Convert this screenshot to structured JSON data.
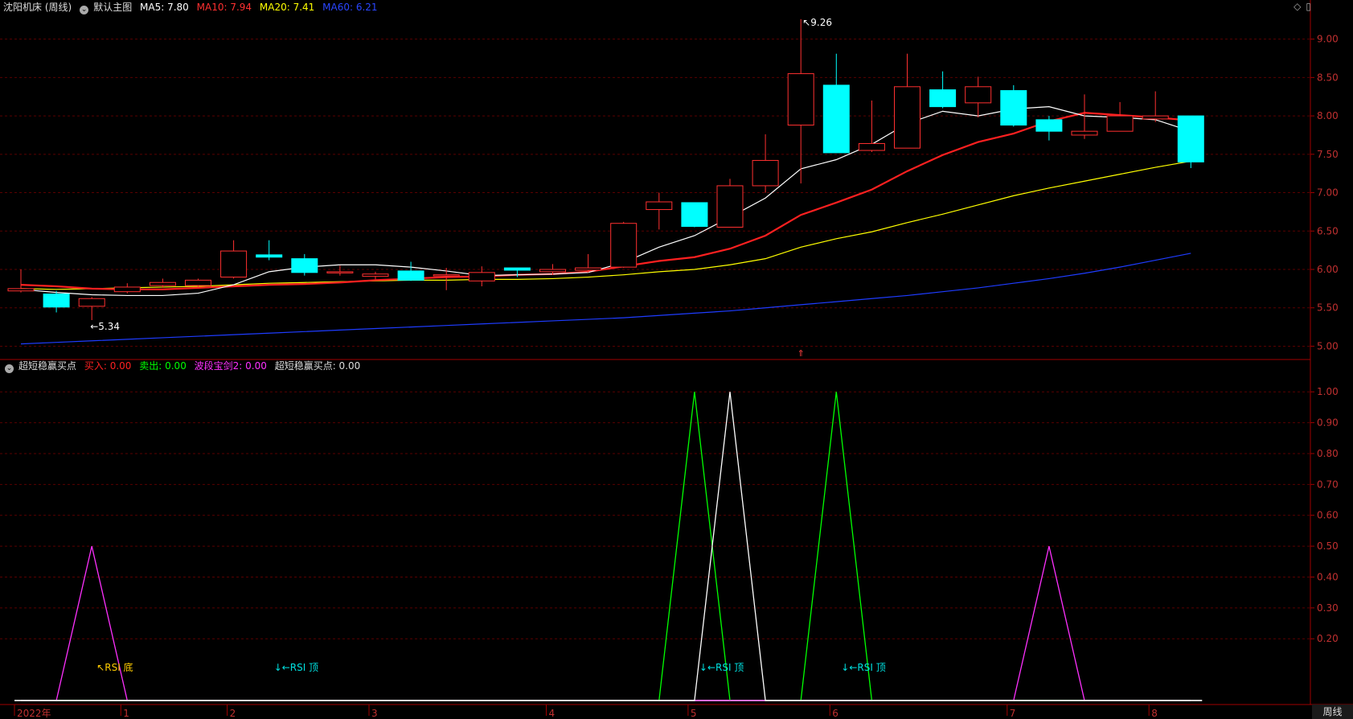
{
  "header": {
    "stock_title": "沈阳机床 (周线)",
    "main_chart_label": "默认主图",
    "ma": [
      {
        "label": "MA5: 7.80",
        "color": "#ffffff"
      },
      {
        "label": "MA10: 7.94",
        "color": "#ff3030"
      },
      {
        "label": "MA20: 7.41",
        "color": "#ffff00"
      },
      {
        "label": "MA60: 6.21",
        "color": "#1e3cff"
      }
    ]
  },
  "indicator_header": {
    "name": "超短稳赢买点",
    "items": [
      {
        "label": "买入: 0.00",
        "color": "#ff2020"
      },
      {
        "label": "卖出: 0.00",
        "color": "#00ff00"
      },
      {
        "label": "波段宝剑2: 0.00",
        "color": "#ff30ff"
      },
      {
        "label": "超短稳赢买点: 0.00",
        "color": "#ffffff"
      }
    ]
  },
  "top_icons": [
    "diamond-icon",
    "window-icon"
  ],
  "period_label": "周线",
  "chart_data": {
    "type": "candlestick",
    "title": "沈阳机床 (周线)",
    "price_axis": {
      "ylim": [
        4.9,
        9.3
      ],
      "ticks": [
        "9.00",
        "8.50",
        "8.00",
        "7.50",
        "7.00",
        "6.50",
        "6.00",
        "5.50",
        "5.00"
      ],
      "tick_values": [
        9.0,
        8.5,
        8.0,
        7.5,
        7.0,
        6.5,
        6.0,
        5.5,
        5.0
      ]
    },
    "candles": [
      {
        "o": 5.72,
        "h": 6.0,
        "l": 5.7,
        "c": 5.75
      },
      {
        "o": 5.68,
        "h": 5.72,
        "l": 5.44,
        "c": 5.51
      },
      {
        "o": 5.52,
        "h": 5.64,
        "l": 5.34,
        "c": 5.62
      },
      {
        "o": 5.71,
        "h": 5.82,
        "l": 5.69,
        "c": 5.77
      },
      {
        "o": 5.79,
        "h": 5.88,
        "l": 5.76,
        "c": 5.83
      },
      {
        "o": 5.79,
        "h": 5.88,
        "l": 5.76,
        "c": 5.86
      },
      {
        "o": 5.9,
        "h": 6.38,
        "l": 5.88,
        "c": 6.24
      },
      {
        "o": 6.19,
        "h": 6.38,
        "l": 6.12,
        "c": 6.16
      },
      {
        "o": 6.14,
        "h": 6.2,
        "l": 5.92,
        "c": 5.96
      },
      {
        "o": 5.97,
        "h": 6.05,
        "l": 5.92,
        "c": 5.97
      },
      {
        "o": 5.91,
        "h": 5.97,
        "l": 5.87,
        "c": 5.94
      },
      {
        "o": 5.98,
        "h": 6.1,
        "l": 5.85,
        "c": 5.86
      },
      {
        "o": 5.93,
        "h": 6.02,
        "l": 5.73,
        "c": 5.93
      },
      {
        "o": 5.85,
        "h": 6.04,
        "l": 5.78,
        "c": 5.96
      },
      {
        "o": 6.02,
        "h": 6.02,
        "l": 5.9,
        "c": 5.99
      },
      {
        "o": 5.97,
        "h": 6.07,
        "l": 5.93,
        "c": 6.0
      },
      {
        "o": 5.99,
        "h": 6.2,
        "l": 5.96,
        "c": 6.02
      },
      {
        "o": 6.03,
        "h": 6.62,
        "l": 6.02,
        "c": 6.6
      },
      {
        "o": 6.78,
        "h": 7.0,
        "l": 6.52,
        "c": 6.88
      },
      {
        "o": 6.87,
        "h": 6.87,
        "l": 6.55,
        "c": 6.56
      },
      {
        "o": 6.55,
        "h": 7.18,
        "l": 6.55,
        "c": 7.09
      },
      {
        "o": 7.09,
        "h": 7.76,
        "l": 7.0,
        "c": 7.42
      },
      {
        "o": 7.88,
        "h": 9.26,
        "l": 7.12,
        "c": 8.55
      },
      {
        "o": 8.4,
        "h": 8.81,
        "l": 7.52,
        "c": 7.52
      },
      {
        "o": 7.55,
        "h": 8.2,
        "l": 7.53,
        "c": 7.64
      },
      {
        "o": 7.58,
        "h": 8.81,
        "l": 7.58,
        "c": 8.38
      },
      {
        "o": 8.34,
        "h": 8.58,
        "l": 8.1,
        "c": 8.12
      },
      {
        "o": 8.17,
        "h": 8.51,
        "l": 7.98,
        "c": 8.38
      },
      {
        "o": 8.33,
        "h": 8.4,
        "l": 7.86,
        "c": 7.88
      },
      {
        "o": 7.95,
        "h": 8.0,
        "l": 7.68,
        "c": 7.8
      },
      {
        "o": 7.75,
        "h": 8.28,
        "l": 7.7,
        "c": 7.8
      },
      {
        "o": 7.8,
        "h": 8.18,
        "l": 7.8,
        "c": 8.0
      },
      {
        "o": 7.96,
        "h": 8.32,
        "l": 7.92,
        "c": 8.0
      },
      {
        "o": 8.0,
        "h": 8.0,
        "l": 7.32,
        "c": 7.4
      }
    ],
    "ma_series": [
      {
        "name": "MA5",
        "color": "#ffffff",
        "values": [
          5.74,
          5.7,
          5.67,
          5.66,
          5.66,
          5.69,
          5.8,
          5.97,
          6.03,
          6.06,
          6.06,
          6.03,
          5.98,
          5.92,
          5.93,
          5.94,
          5.96,
          6.09,
          6.29,
          6.44,
          6.68,
          6.93,
          7.31,
          7.43,
          7.63,
          7.9,
          8.06,
          8.0,
          8.09,
          8.12,
          8.0,
          7.98,
          7.95,
          7.8
        ]
      },
      {
        "name": "MA10",
        "color": "#ff2020",
        "values": [
          5.8,
          5.78,
          5.75,
          5.74,
          5.74,
          5.76,
          5.78,
          5.8,
          5.81,
          5.83,
          5.86,
          5.88,
          5.9,
          5.91,
          5.93,
          5.94,
          5.97,
          6.04,
          6.11,
          6.16,
          6.27,
          6.44,
          6.71,
          6.87,
          7.04,
          7.28,
          7.49,
          7.66,
          7.77,
          7.93,
          8.04,
          8.01,
          7.98,
          7.94
        ]
      },
      {
        "name": "MA20",
        "color": "#ffff00",
        "values": [
          5.75,
          5.74,
          5.75,
          5.76,
          5.77,
          5.78,
          5.8,
          5.82,
          5.83,
          5.84,
          5.85,
          5.86,
          5.86,
          5.87,
          5.87,
          5.88,
          5.9,
          5.93,
          5.97,
          6.0,
          6.06,
          6.14,
          6.29,
          6.4,
          6.49,
          6.61,
          6.72,
          6.84,
          6.96,
          7.06,
          7.15,
          7.24,
          7.33,
          7.41
        ]
      },
      {
        "name": "MA60",
        "color": "#1e3cff",
        "values": [
          5.03,
          5.05,
          5.07,
          5.09,
          5.11,
          5.13,
          5.15,
          5.17,
          5.19,
          5.21,
          5.23,
          5.25,
          5.27,
          5.29,
          5.31,
          5.33,
          5.35,
          5.37,
          5.4,
          5.43,
          5.46,
          5.5,
          5.54,
          5.58,
          5.62,
          5.66,
          5.71,
          5.76,
          5.82,
          5.88,
          5.95,
          6.03,
          6.12,
          6.21
        ]
      }
    ],
    "annotations": [
      {
        "text": "9.26",
        "value": 9.26
      },
      {
        "text": "5.34",
        "value": 5.34
      }
    ],
    "indicator_axis": {
      "ylim": [
        0,
        1.05
      ],
      "ticks": [
        "1.00",
        "0.90",
        "0.80",
        "0.70",
        "0.60",
        "0.50",
        "0.40",
        "0.30",
        "0.20"
      ],
      "tick_values": [
        1.0,
        0.9,
        0.8,
        0.7,
        0.6,
        0.5,
        0.4,
        0.3,
        0.2
      ]
    },
    "indicator_series": [
      {
        "name": "卖出",
        "color": "#00ff00",
        "values": [
          0,
          0,
          0,
          0,
          0,
          0,
          0,
          0,
          0,
          0,
          0,
          0,
          0,
          0,
          0,
          0,
          0,
          0,
          0,
          1,
          0,
          0,
          0,
          1,
          0,
          0,
          0,
          0,
          0,
          0,
          0,
          0,
          0,
          0
        ]
      },
      {
        "name": "波段宝剑2",
        "color": "#ff30ff",
        "values": [
          0,
          0,
          0.5,
          0,
          0,
          0,
          0,
          0,
          0,
          0,
          0,
          0,
          0,
          0,
          0,
          0,
          0,
          0,
          0,
          0,
          0,
          0,
          0,
          0,
          0,
          0,
          0,
          0,
          0,
          0.5,
          0,
          0,
          0,
          0
        ]
      },
      {
        "name": "超短稳赢买点",
        "color": "#ffffff",
        "values": [
          0,
          0,
          0,
          0,
          0,
          0,
          0,
          0,
          0,
          0,
          0,
          0,
          0,
          0,
          0,
          0,
          0,
          0,
          0,
          0,
          1,
          0,
          0,
          0,
          0,
          0,
          0,
          0,
          0,
          0,
          0,
          0,
          0,
          0
        ]
      }
    ],
    "indicator_labels": [
      {
        "text": "↖RSI 底",
        "color": "#ffcc00",
        "index": 2
      },
      {
        "text": "↓←RSI 顶",
        "color": "#00e0e0",
        "index": 7
      },
      {
        "text": "↓←RSI 顶",
        "color": "#00e0e0",
        "index": 19
      },
      {
        "text": "↓←RSI 顶",
        "color": "#00e0e0",
        "index": 23
      }
    ],
    "x_axis_labels": [
      {
        "text": "2022年",
        "index": 0
      },
      {
        "text": "1",
        "index": 3
      },
      {
        "text": "2",
        "index": 6
      },
      {
        "text": "3",
        "index": 10
      },
      {
        "text": "4",
        "index": 15
      },
      {
        "text": "5",
        "index": 19
      },
      {
        "text": "6",
        "index": 23
      },
      {
        "text": "7",
        "index": 28
      },
      {
        "text": "8",
        "index": 32
      }
    ]
  }
}
